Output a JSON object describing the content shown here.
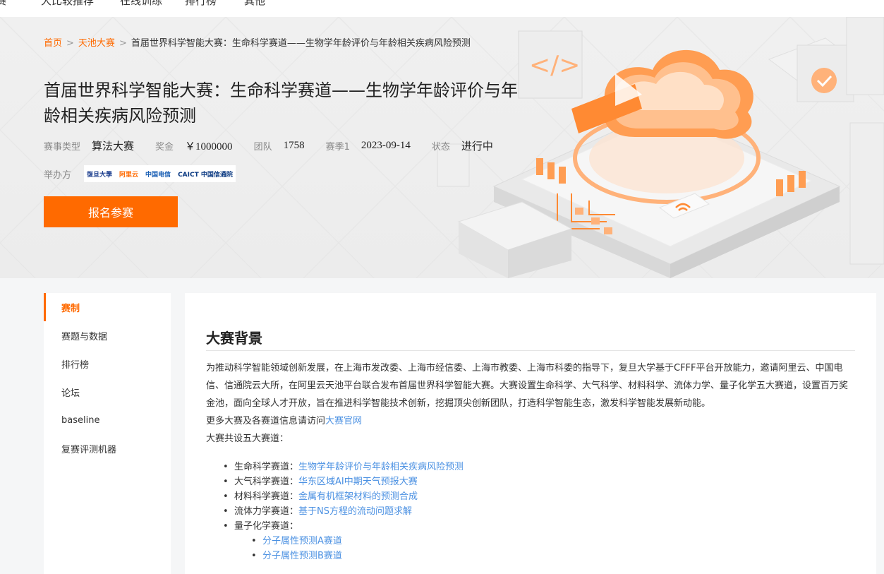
{
  "topnav": {
    "items": [
      "赛",
      "大比较推荐",
      "在线训练",
      "排行榜",
      "其他"
    ]
  },
  "breadcrumb": {
    "home": "首页",
    "tianchi": "天池大赛",
    "current": "首届世界科学智能大赛：生命科学赛道——生物学年龄评价与年龄相关疾病风险预测"
  },
  "header": {
    "title": "首届世界科学智能大赛：生命科学赛道——生物学年龄评价与年龄相关疾病风险预测",
    "meta": {
      "type_label": "赛事类型",
      "type_value": "算法大赛",
      "prize_label": "奖金",
      "prize_value": "￥1000000",
      "team_label": "团队",
      "team_value": "1758",
      "season_label": "赛季1",
      "season_value": "2023-09-14",
      "status_label": "状态",
      "status_value": "进行中"
    },
    "organizer_label": "举办方",
    "organizers": [
      "復旦大學",
      "阿里云",
      "中国电信",
      "CAICT 中国信通院"
    ],
    "signup": "报名参赛"
  },
  "sidebar": {
    "items": [
      {
        "label": "赛制",
        "active": true
      },
      {
        "label": "赛题与数据"
      },
      {
        "label": "排行榜"
      },
      {
        "label": "论坛"
      },
      {
        "label": "baseline"
      },
      {
        "label": "复赛评测机器"
      }
    ]
  },
  "content": {
    "section_title": "大赛背景",
    "para1": "为推动科学智能领域创新发展，在上海市发改委、上海市经信委、上海市教委、上海市科委的指导下，复旦大学基于CFFF平台开放能力，邀请阿里云、中国电信、信通院云大所，在阿里云天池平台联合发布首届世界科学智能大赛。大赛设置生命科学、大气科学、材料科学、流体力学、量子化学五大赛道，设置百万奖金池，面向全球人才开放，旨在推进科学智能技术创新，挖掘顶尖创新团队，打造科学智能生态，激发科学智能发展新动能。",
    "para2_prefix": "更多大赛及各赛道信息请访问",
    "para2_link": "大赛官网",
    "para3": "大赛共设五大赛道：",
    "tracks": [
      {
        "name": "生命科学赛道：",
        "link": "生物学年龄评价与年龄相关疾病风险预测"
      },
      {
        "name": "大气科学赛道：",
        "link": "华东区域AI中期天气预报大赛"
      },
      {
        "name": "材料科学赛道：",
        "link": "金属有机框架材料的预测合成"
      },
      {
        "name": "流体力学赛道：",
        "link": "基于NS方程的流动问题求解"
      },
      {
        "name": "量子化学赛道：",
        "link": ""
      }
    ],
    "subtracks": [
      "分子属性预测A赛道",
      "分子属性预测B赛道"
    ]
  },
  "colors": {
    "accent": "#ff6a00",
    "link": "#4a90e2"
  }
}
